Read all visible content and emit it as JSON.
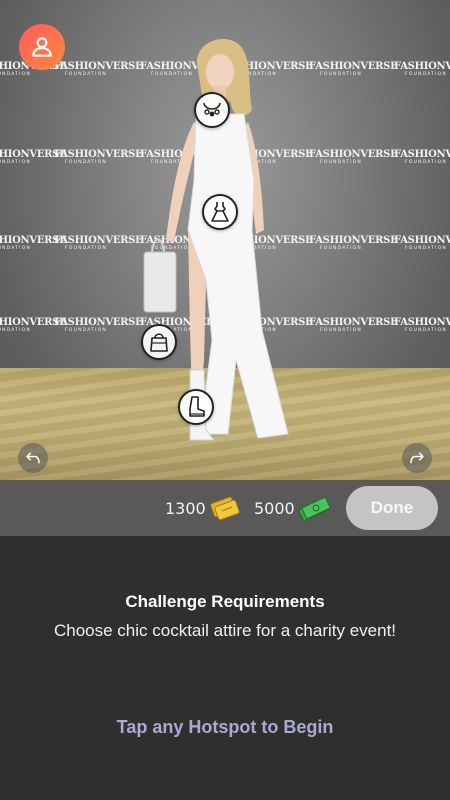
{
  "backdrop": {
    "logo_word": "FASHIONVERSE",
    "logo_sub": "FOUNDATION"
  },
  "hotspots": [
    {
      "name": "necklace-hotspot",
      "icon": "necklace-icon"
    },
    {
      "name": "dress-hotspot",
      "icon": "dress-icon"
    },
    {
      "name": "handbag-hotspot",
      "icon": "handbag-icon"
    },
    {
      "name": "boots-hotspot",
      "icon": "boot-icon"
    }
  ],
  "toolbar": {
    "tickets": "1300",
    "cash": "5000",
    "done_label": "Done"
  },
  "challenge": {
    "title": "Challenge Requirements",
    "description": "Choose chic cocktail attire for a charity event!",
    "cta": "Tap any Hotspot to Begin"
  },
  "colors": {
    "profile_gradient": [
      "#ff5a5a",
      "#ff8a3d"
    ],
    "panel_bg": "#2f302e",
    "toolbar_bg": "#595959",
    "cta": "#a9a9d4",
    "done_bg": "#c4c4c4"
  }
}
